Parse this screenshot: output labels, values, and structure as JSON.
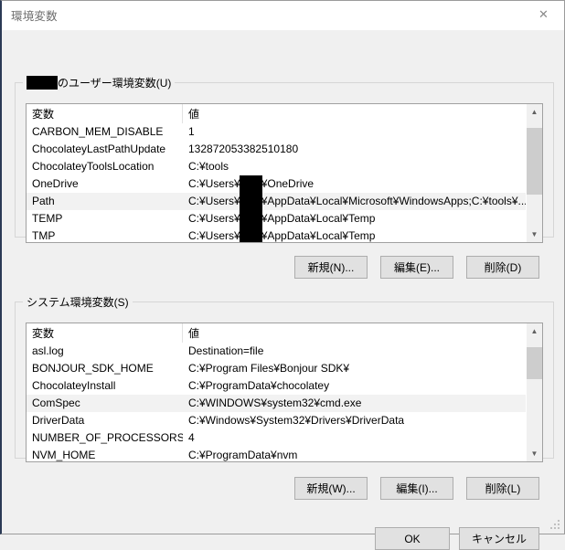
{
  "window": {
    "title": "環境変数",
    "close_icon": "close-icon"
  },
  "user_section": {
    "legend_suffix": "のユーザー環境変数(U)",
    "legend_redacted": true,
    "columns": {
      "name": "変数",
      "value": "値"
    },
    "rows": [
      {
        "name": "CARBON_MEM_DISABLE",
        "value_prefix": "1",
        "redacted": false,
        "value_suffix": "",
        "selected": false
      },
      {
        "name": "ChocolateyLastPathUpdate",
        "value_prefix": "132872053382510180",
        "redacted": false,
        "value_suffix": "",
        "selected": false
      },
      {
        "name": "ChocolateyToolsLocation",
        "value_prefix": "C:¥tools",
        "redacted": false,
        "value_suffix": "",
        "selected": false
      },
      {
        "name": "OneDrive",
        "value_prefix": "C:¥Users¥",
        "redacted": true,
        "value_suffix": "¥OneDrive",
        "selected": false
      },
      {
        "name": "Path",
        "value_prefix": "C:¥Users¥",
        "redacted": true,
        "value_suffix": "¥AppData¥Local¥Microsoft¥WindowsApps;C:¥tools¥...",
        "selected": true
      },
      {
        "name": "TEMP",
        "value_prefix": "C:¥Users¥",
        "redacted": true,
        "value_suffix": "¥AppData¥Local¥Temp",
        "selected": false
      },
      {
        "name": "TMP",
        "value_prefix": "C:¥Users¥",
        "redacted": true,
        "value_suffix": "¥AppData¥Local¥Temp",
        "selected": false
      }
    ],
    "scrollbar": {
      "thumb_top_pct": 8,
      "thumb_height_pct": 62
    },
    "buttons": {
      "new": "新規(N)...",
      "edit": "編集(E)...",
      "delete": "削除(D)"
    }
  },
  "system_section": {
    "legend": "システム環境変数(S)",
    "columns": {
      "name": "変数",
      "value": "値"
    },
    "rows": [
      {
        "name": "asl.log",
        "value_prefix": "Destination=file",
        "redacted": false,
        "value_suffix": "",
        "selected": false
      },
      {
        "name": "BONJOUR_SDK_HOME",
        "value_prefix": "C:¥Program Files¥Bonjour SDK¥",
        "redacted": false,
        "value_suffix": "",
        "selected": false
      },
      {
        "name": "ChocolateyInstall",
        "value_prefix": "C:¥ProgramData¥chocolatey",
        "redacted": false,
        "value_suffix": "",
        "selected": false
      },
      {
        "name": "ComSpec",
        "value_prefix": "C:¥WINDOWS¥system32¥cmd.exe",
        "redacted": false,
        "value_suffix": "",
        "selected": true
      },
      {
        "name": "DriverData",
        "value_prefix": "C:¥Windows¥System32¥Drivers¥DriverData",
        "redacted": false,
        "value_suffix": "",
        "selected": false
      },
      {
        "name": "NUMBER_OF_PROCESSORS",
        "value_prefix": "4",
        "redacted": false,
        "value_suffix": "",
        "selected": false
      },
      {
        "name": "NVM_HOME",
        "value_prefix": "C:¥ProgramData¥nvm",
        "redacted": false,
        "value_suffix": "",
        "selected": false
      }
    ],
    "scrollbar": {
      "thumb_top_pct": 8,
      "thumb_height_pct": 30
    },
    "buttons": {
      "new": "新規(W)...",
      "edit": "編集(I)...",
      "delete": "削除(L)"
    }
  },
  "footer": {
    "ok": "OK",
    "cancel": "キャンセル"
  },
  "colors": {
    "window_bg": "#f0f0f0",
    "titlebar_bg": "#ffffff",
    "title_text": "#6d6d6d",
    "accent_border": "#2b3a55",
    "list_bg": "#ffffff",
    "selected_row": "#f2f2f2",
    "button_face": "#e1e1e1",
    "button_border": "#adadad",
    "scroll_thumb": "#cdcdcd",
    "redaction": "#000000"
  }
}
